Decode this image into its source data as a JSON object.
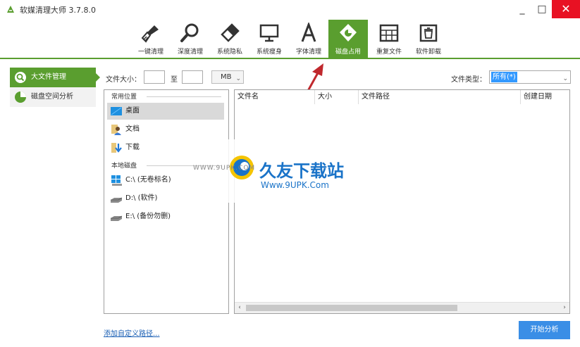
{
  "window": {
    "title": "软媒清理大师 3.7.8.0",
    "min_glyph": "_",
    "max_glyph": "□",
    "close_glyph": "✕"
  },
  "toolbar": {
    "items": [
      {
        "label": "一键清理",
        "icon": "broom-icon"
      },
      {
        "label": "深度清理",
        "icon": "magnifier-icon"
      },
      {
        "label": "系统隐私",
        "icon": "eraser-icon"
      },
      {
        "label": "系统瘦身",
        "icon": "monitor-icon"
      },
      {
        "label": "字体清理",
        "icon": "font-a-icon"
      },
      {
        "label": "磁盘占用",
        "icon": "disk-pie-icon",
        "active": true
      },
      {
        "label": "重复文件",
        "icon": "grid-files-icon"
      },
      {
        "label": "软件卸载",
        "icon": "trash-box-icon"
      }
    ],
    "accent": "#5a9e2f"
  },
  "sidebar": {
    "items": [
      {
        "label": "大文件管理",
        "active": true
      },
      {
        "label": "磁盘空间分析",
        "active": false
      }
    ]
  },
  "filters": {
    "size_label": "文件大小：",
    "to_label": "至",
    "min_value": "",
    "max_value": "",
    "unit": "MB",
    "type_label": "文件类型：",
    "type_value": "所有(*)"
  },
  "locations": {
    "common_header": "常用位置",
    "common": [
      {
        "label": "桌面",
        "selected": true
      },
      {
        "label": "文档"
      },
      {
        "label": "下载"
      }
    ],
    "disk_header": "本地磁盘",
    "disks": [
      {
        "label": "C:\\ (无卷标名)"
      },
      {
        "label": "D:\\ (软件)"
      },
      {
        "label": "E:\\ (备份勿删)"
      }
    ]
  },
  "results": {
    "columns": [
      "文件名",
      "大小",
      "文件路径",
      "创建日期"
    ]
  },
  "footer": {
    "add_path": "添加自定义路径...",
    "start": "开始分析"
  },
  "watermark": {
    "big": "久友下载站",
    "url": "Www.9UPK.Com",
    "url_left": "WWW.9UPK.COM"
  }
}
